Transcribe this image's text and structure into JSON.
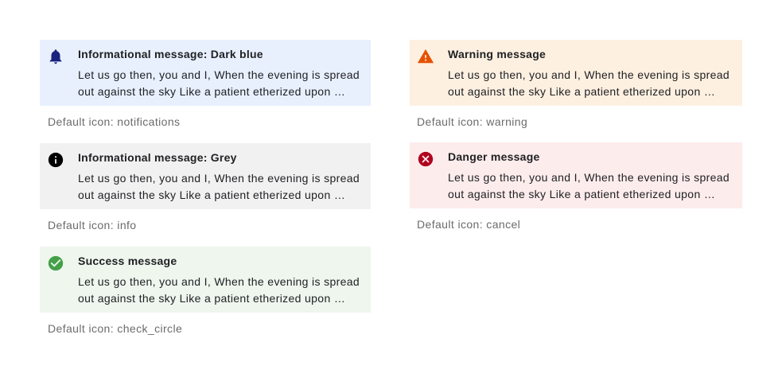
{
  "body_text": "Let us go then, you and I, When the evening is spread out against the sky Like a patient etherized upon …",
  "messages": {
    "info_dark_blue": {
      "title": "Informational message: Dark blue",
      "caption": "Default icon: notifications",
      "icon": "notifications-icon",
      "bg": "#e8f0fe",
      "icon_color": "#1a237e"
    },
    "info_grey": {
      "title": "Informational message: Grey",
      "caption": "Default icon: info",
      "icon": "info-icon",
      "bg": "#f1f1f1",
      "icon_color": "#000000"
    },
    "success": {
      "title": "Success message",
      "caption": "Default icon: check_circle",
      "icon": "check-circle-icon",
      "bg": "#eef6ee",
      "icon_color": "#43a047"
    },
    "warning": {
      "title": "Warning message",
      "caption": "Default icon: warning",
      "icon": "warning-icon",
      "bg": "#fdf0e1",
      "icon_color": "#e65100"
    },
    "danger": {
      "title": "Danger message",
      "caption": "Default icon: cancel",
      "icon": "cancel-icon",
      "bg": "#fdecec",
      "icon_color": "#b0001f"
    }
  }
}
